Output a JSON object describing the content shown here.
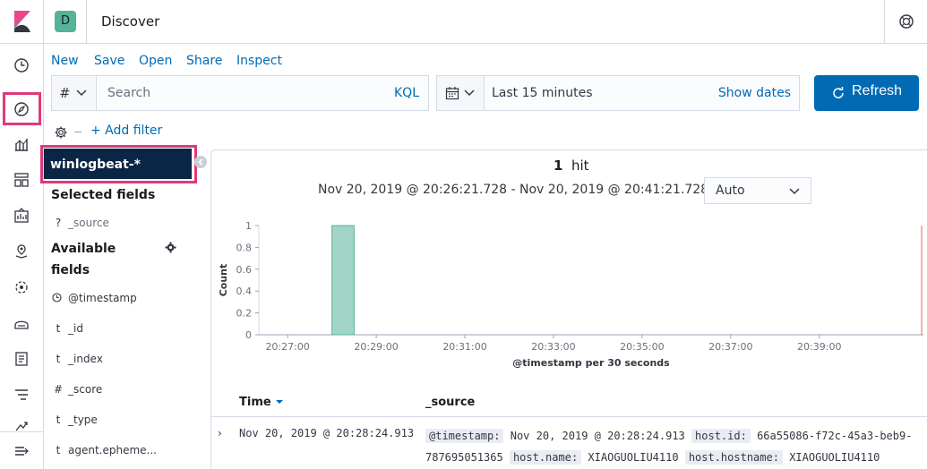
{
  "header": {
    "space_initial": "D",
    "page_title": "Discover"
  },
  "top_menu": {
    "new": "New",
    "save": "Save",
    "open": "Open",
    "share": "Share",
    "inspect": "Inspect"
  },
  "query_bar": {
    "language_symbol": "#",
    "search_placeholder": "Search",
    "language": "KQL"
  },
  "date_picker": {
    "range": "Last 15 minutes",
    "show_dates": "Show dates"
  },
  "refresh_label": "Refresh",
  "add_filter": "+ Add filter",
  "sidebar": {
    "index_pattern": "winlogbeat-*",
    "selected_title": "Selected fields",
    "selected": [
      {
        "type": "?",
        "name": "_source"
      }
    ],
    "available_title_1": "Available",
    "available_title_2": "fields",
    "available": [
      {
        "type": "clock",
        "name": "@timestamp"
      },
      {
        "type": "t",
        "name": "_id"
      },
      {
        "type": "t",
        "name": "_index"
      },
      {
        "type": "#",
        "name": "_score"
      },
      {
        "type": "t",
        "name": "_type"
      },
      {
        "type": "t",
        "name": "agent.epheme..."
      }
    ]
  },
  "results": {
    "hit_count": "1",
    "hit_label": "hit",
    "time_range": "Nov 20, 2019 @ 20:26:21.728 - Nov 20, 2019 @ 20:41:21.728 —",
    "interval": "Auto"
  },
  "chart_data": {
    "type": "bar",
    "ylabel": "Count",
    "xlabel": "@timestamp per 30 seconds",
    "ylim": [
      0,
      1
    ],
    "y_ticks": [
      "0",
      "0.2",
      "0.4",
      "0.6",
      "0.8",
      "1"
    ],
    "x_ticks": [
      "20:27:00",
      "20:29:00",
      "20:31:00",
      "20:33:00",
      "20:35:00",
      "20:37:00",
      "20:39:00"
    ],
    "series": [
      {
        "x": [
          "20:28:00"
        ],
        "values": [
          1
        ]
      }
    ],
    "bar_color": "#54b399"
  },
  "table": {
    "col_time": "Time",
    "col_source": "_source",
    "rows": [
      {
        "time": "Nov 20, 2019 @ 20:28:24.913",
        "k1": "@timestamp:",
        "v1": "Nov 20, 2019 @ 20:28:24.913",
        "k2": "host.id:",
        "v2": "66a55086-f72c-45a3-beb9-",
        "v2b": "787695051365",
        "k3": "host.name:",
        "v3": "XIAOGUOLIU4110",
        "k4": "host.hostname:",
        "v4": "XIAOGUOLIU4110"
      }
    ]
  },
  "colors": {
    "accent": "#006bb4",
    "highlight": "#e0397b",
    "index_bg": "#0b2545"
  }
}
